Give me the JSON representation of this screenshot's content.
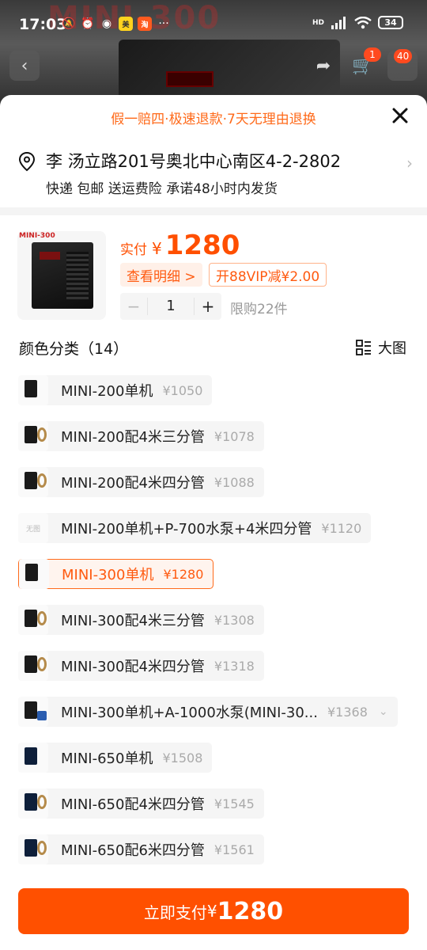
{
  "status_bar": {
    "time": "17:03",
    "battery": "34",
    "network": "HD"
  },
  "background": {
    "title_text": "MINI-300",
    "cart_badge": "1",
    "more_badge": "40"
  },
  "sheet": {
    "promo": "假一赔四·极速退款·7天无理由退换",
    "address": {
      "line": "李 汤立路201号奥北中心南区4-2-2802",
      "services": "快递 包邮 送运费险 承诺48小时内发货"
    },
    "product": {
      "brand_label": "MINI-300",
      "price_label": "实付",
      "currency": "¥",
      "price": "1280",
      "detail_tag": "查看明细 >",
      "vip_tag": "开88VIP减¥2.00",
      "quantity": "1",
      "minus": "−",
      "plus": "+",
      "limit": "限购22件"
    },
    "section": {
      "title": "颜色分类（14）",
      "big_view": "大图"
    },
    "options": [
      {
        "name": "MINI-200单机",
        "price": "¥1050",
        "thumb": "unit"
      },
      {
        "name": "MINI-200配4米三分管",
        "price": "¥1078",
        "thumb": "coil"
      },
      {
        "name": "MINI-200配4米四分管",
        "price": "¥1088",
        "thumb": "coil"
      },
      {
        "name": "MINI-200单机+P-700水泵+4米四分管",
        "price": "¥1120",
        "thumb": "none",
        "noimg_text": "无图"
      },
      {
        "name": "MINI-300单机",
        "price": "¥1280",
        "thumb": "unit",
        "selected": true
      },
      {
        "name": "MINI-300配4米三分管",
        "price": "¥1308",
        "thumb": "coil"
      },
      {
        "name": "MINI-300配4米四分管",
        "price": "¥1318",
        "thumb": "coil"
      },
      {
        "name": "MINI-300单机+A-1000水泵(MINI-30...",
        "price": "¥1368",
        "thumb": "pump",
        "expandable": true
      },
      {
        "name": "MINI-650单机",
        "price": "¥1508",
        "thumb": "blue"
      },
      {
        "name": "MINI-650配4米四分管",
        "price": "¥1545",
        "thumb": "bluecoil"
      },
      {
        "name": "MINI-650配6米四分管",
        "price": "¥1561",
        "thumb": "bluecoil"
      }
    ],
    "pay": {
      "label": "立即支付",
      "currency": "¥",
      "amount": "1280"
    }
  },
  "colors": {
    "accent": "#ff5000",
    "promo": "#ff6a1a"
  }
}
